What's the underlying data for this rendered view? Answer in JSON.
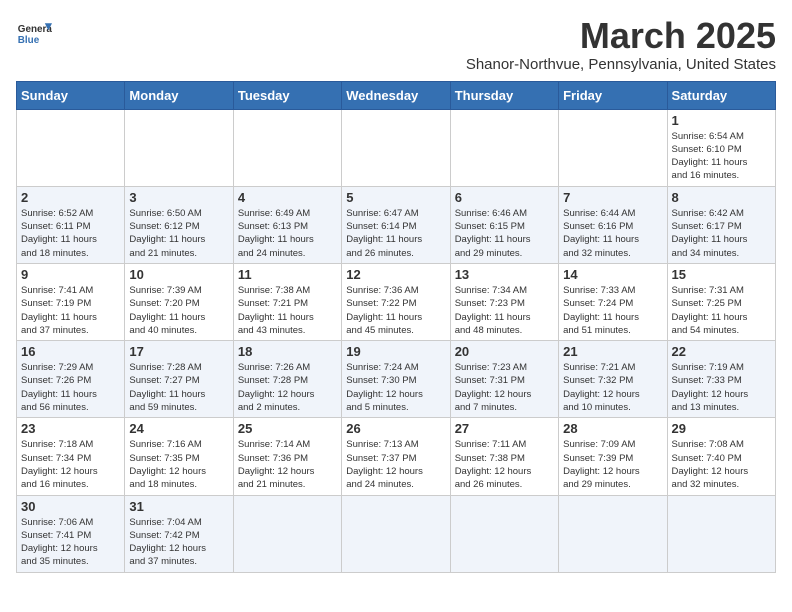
{
  "header": {
    "logo_general": "General",
    "logo_blue": "Blue",
    "month_title": "March 2025",
    "location": "Shanor-Northvue, Pennsylvania, United States"
  },
  "weekdays": [
    "Sunday",
    "Monday",
    "Tuesday",
    "Wednesday",
    "Thursday",
    "Friday",
    "Saturday"
  ],
  "weeks": [
    [
      {
        "day": "",
        "info": ""
      },
      {
        "day": "",
        "info": ""
      },
      {
        "day": "",
        "info": ""
      },
      {
        "day": "",
        "info": ""
      },
      {
        "day": "",
        "info": ""
      },
      {
        "day": "",
        "info": ""
      },
      {
        "day": "1",
        "info": "Sunrise: 6:54 AM\nSunset: 6:10 PM\nDaylight: 11 hours\nand 16 minutes."
      }
    ],
    [
      {
        "day": "2",
        "info": "Sunrise: 6:52 AM\nSunset: 6:11 PM\nDaylight: 11 hours\nand 18 minutes."
      },
      {
        "day": "3",
        "info": "Sunrise: 6:50 AM\nSunset: 6:12 PM\nDaylight: 11 hours\nand 21 minutes."
      },
      {
        "day": "4",
        "info": "Sunrise: 6:49 AM\nSunset: 6:13 PM\nDaylight: 11 hours\nand 24 minutes."
      },
      {
        "day": "5",
        "info": "Sunrise: 6:47 AM\nSunset: 6:14 PM\nDaylight: 11 hours\nand 26 minutes."
      },
      {
        "day": "6",
        "info": "Sunrise: 6:46 AM\nSunset: 6:15 PM\nDaylight: 11 hours\nand 29 minutes."
      },
      {
        "day": "7",
        "info": "Sunrise: 6:44 AM\nSunset: 6:16 PM\nDaylight: 11 hours\nand 32 minutes."
      },
      {
        "day": "8",
        "info": "Sunrise: 6:42 AM\nSunset: 6:17 PM\nDaylight: 11 hours\nand 34 minutes."
      }
    ],
    [
      {
        "day": "9",
        "info": "Sunrise: 7:41 AM\nSunset: 7:19 PM\nDaylight: 11 hours\nand 37 minutes."
      },
      {
        "day": "10",
        "info": "Sunrise: 7:39 AM\nSunset: 7:20 PM\nDaylight: 11 hours\nand 40 minutes."
      },
      {
        "day": "11",
        "info": "Sunrise: 7:38 AM\nSunset: 7:21 PM\nDaylight: 11 hours\nand 43 minutes."
      },
      {
        "day": "12",
        "info": "Sunrise: 7:36 AM\nSunset: 7:22 PM\nDaylight: 11 hours\nand 45 minutes."
      },
      {
        "day": "13",
        "info": "Sunrise: 7:34 AM\nSunset: 7:23 PM\nDaylight: 11 hours\nand 48 minutes."
      },
      {
        "day": "14",
        "info": "Sunrise: 7:33 AM\nSunset: 7:24 PM\nDaylight: 11 hours\nand 51 minutes."
      },
      {
        "day": "15",
        "info": "Sunrise: 7:31 AM\nSunset: 7:25 PM\nDaylight: 11 hours\nand 54 minutes."
      }
    ],
    [
      {
        "day": "16",
        "info": "Sunrise: 7:29 AM\nSunset: 7:26 PM\nDaylight: 11 hours\nand 56 minutes."
      },
      {
        "day": "17",
        "info": "Sunrise: 7:28 AM\nSunset: 7:27 PM\nDaylight: 11 hours\nand 59 minutes."
      },
      {
        "day": "18",
        "info": "Sunrise: 7:26 AM\nSunset: 7:28 PM\nDaylight: 12 hours\nand 2 minutes."
      },
      {
        "day": "19",
        "info": "Sunrise: 7:24 AM\nSunset: 7:30 PM\nDaylight: 12 hours\nand 5 minutes."
      },
      {
        "day": "20",
        "info": "Sunrise: 7:23 AM\nSunset: 7:31 PM\nDaylight: 12 hours\nand 7 minutes."
      },
      {
        "day": "21",
        "info": "Sunrise: 7:21 AM\nSunset: 7:32 PM\nDaylight: 12 hours\nand 10 minutes."
      },
      {
        "day": "22",
        "info": "Sunrise: 7:19 AM\nSunset: 7:33 PM\nDaylight: 12 hours\nand 13 minutes."
      }
    ],
    [
      {
        "day": "23",
        "info": "Sunrise: 7:18 AM\nSunset: 7:34 PM\nDaylight: 12 hours\nand 16 minutes."
      },
      {
        "day": "24",
        "info": "Sunrise: 7:16 AM\nSunset: 7:35 PM\nDaylight: 12 hours\nand 18 minutes."
      },
      {
        "day": "25",
        "info": "Sunrise: 7:14 AM\nSunset: 7:36 PM\nDaylight: 12 hours\nand 21 minutes."
      },
      {
        "day": "26",
        "info": "Sunrise: 7:13 AM\nSunset: 7:37 PM\nDaylight: 12 hours\nand 24 minutes."
      },
      {
        "day": "27",
        "info": "Sunrise: 7:11 AM\nSunset: 7:38 PM\nDaylight: 12 hours\nand 26 minutes."
      },
      {
        "day": "28",
        "info": "Sunrise: 7:09 AM\nSunset: 7:39 PM\nDaylight: 12 hours\nand 29 minutes."
      },
      {
        "day": "29",
        "info": "Sunrise: 7:08 AM\nSunset: 7:40 PM\nDaylight: 12 hours\nand 32 minutes."
      }
    ],
    [
      {
        "day": "30",
        "info": "Sunrise: 7:06 AM\nSunset: 7:41 PM\nDaylight: 12 hours\nand 35 minutes."
      },
      {
        "day": "31",
        "info": "Sunrise: 7:04 AM\nSunset: 7:42 PM\nDaylight: 12 hours\nand 37 minutes."
      },
      {
        "day": "",
        "info": ""
      },
      {
        "day": "",
        "info": ""
      },
      {
        "day": "",
        "info": ""
      },
      {
        "day": "",
        "info": ""
      },
      {
        "day": "",
        "info": ""
      }
    ]
  ]
}
